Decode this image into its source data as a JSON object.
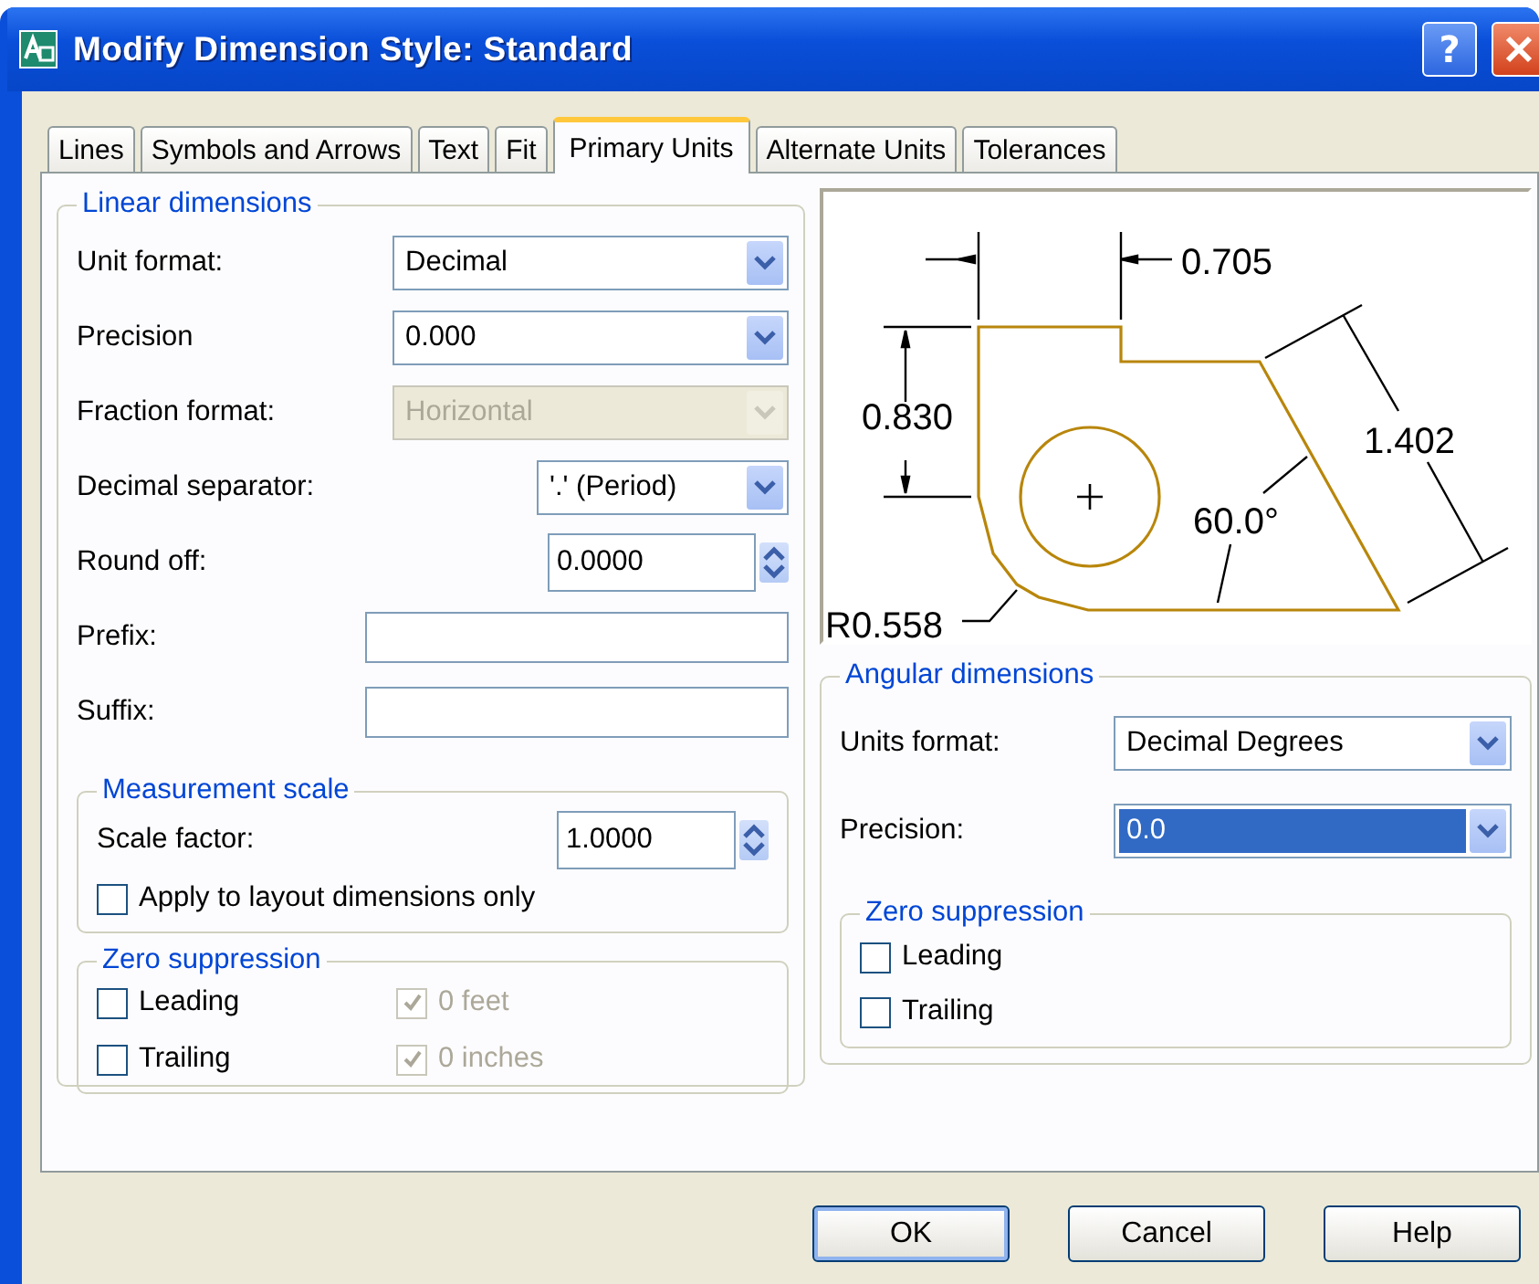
{
  "window": {
    "title": "Modify Dimension Style: Standard",
    "help_label": "?"
  },
  "tabs": [
    {
      "label": "Lines",
      "selected": false
    },
    {
      "label": "Symbols and Arrows",
      "selected": false
    },
    {
      "label": "Text",
      "selected": false
    },
    {
      "label": "Fit",
      "selected": false
    },
    {
      "label": "Primary Units",
      "selected": true
    },
    {
      "label": "Alternate Units",
      "selected": false
    },
    {
      "label": "Tolerances",
      "selected": false
    }
  ],
  "linear_dimensions": {
    "title": "Linear dimensions",
    "fields": [
      {
        "label": "Unit format:",
        "kind": "dropdown",
        "value": "Decimal",
        "disabled": false
      },
      {
        "label": "Precision",
        "kind": "dropdown",
        "value": "0.000",
        "disabled": false
      },
      {
        "label": "Fraction format:",
        "kind": "dropdown",
        "value": "Horizontal",
        "disabled": true
      },
      {
        "label": "Decimal separator:",
        "kind": "short_dropdown",
        "value": "'.' (Period)",
        "disabled": false
      },
      {
        "label": "Round off:",
        "kind": "spinner",
        "value": "0.0000",
        "disabled": false
      },
      {
        "label": "Prefix:",
        "kind": "text",
        "disabled": false
      },
      {
        "label": "Suffix:",
        "kind": "text",
        "disabled": false
      }
    ],
    "measurement_scale": {
      "title": "Measurement scale",
      "scale_factor": {
        "label": "Scale factor:",
        "value": "1.0000"
      },
      "apply_layout": {
        "label": "Apply to layout dimensions only",
        "checked": false
      }
    },
    "zero_suppression": {
      "title": "Zero suppression",
      "items": [
        {
          "label": "Leading",
          "checked": false,
          "disabled": false
        },
        {
          "label": "0 feet",
          "checked": true,
          "disabled": true
        },
        {
          "label": "Trailing",
          "checked": false,
          "disabled": false
        },
        {
          "label": "0 inches",
          "checked": true,
          "disabled": true
        }
      ]
    }
  },
  "preview": {
    "labels": [
      "0.705",
      "0.830",
      "1.402",
      "60.0°",
      "R0.558"
    ]
  },
  "angular_dimensions": {
    "title": "Angular dimensions",
    "fields": [
      {
        "label": "Units format:",
        "value": "Decimal Degrees",
        "focused": false
      },
      {
        "label": "Precision:",
        "value": "0.0",
        "focused": true
      }
    ],
    "zero_suppression": {
      "title": "Zero suppression",
      "items": [
        {
          "label": "Leading",
          "checked": false
        },
        {
          "label": "Trailing",
          "checked": false
        }
      ]
    }
  },
  "buttons": [
    {
      "label": "OK",
      "default": true
    },
    {
      "label": "Cancel",
      "default": false
    },
    {
      "label": "Help",
      "default": false
    }
  ]
}
